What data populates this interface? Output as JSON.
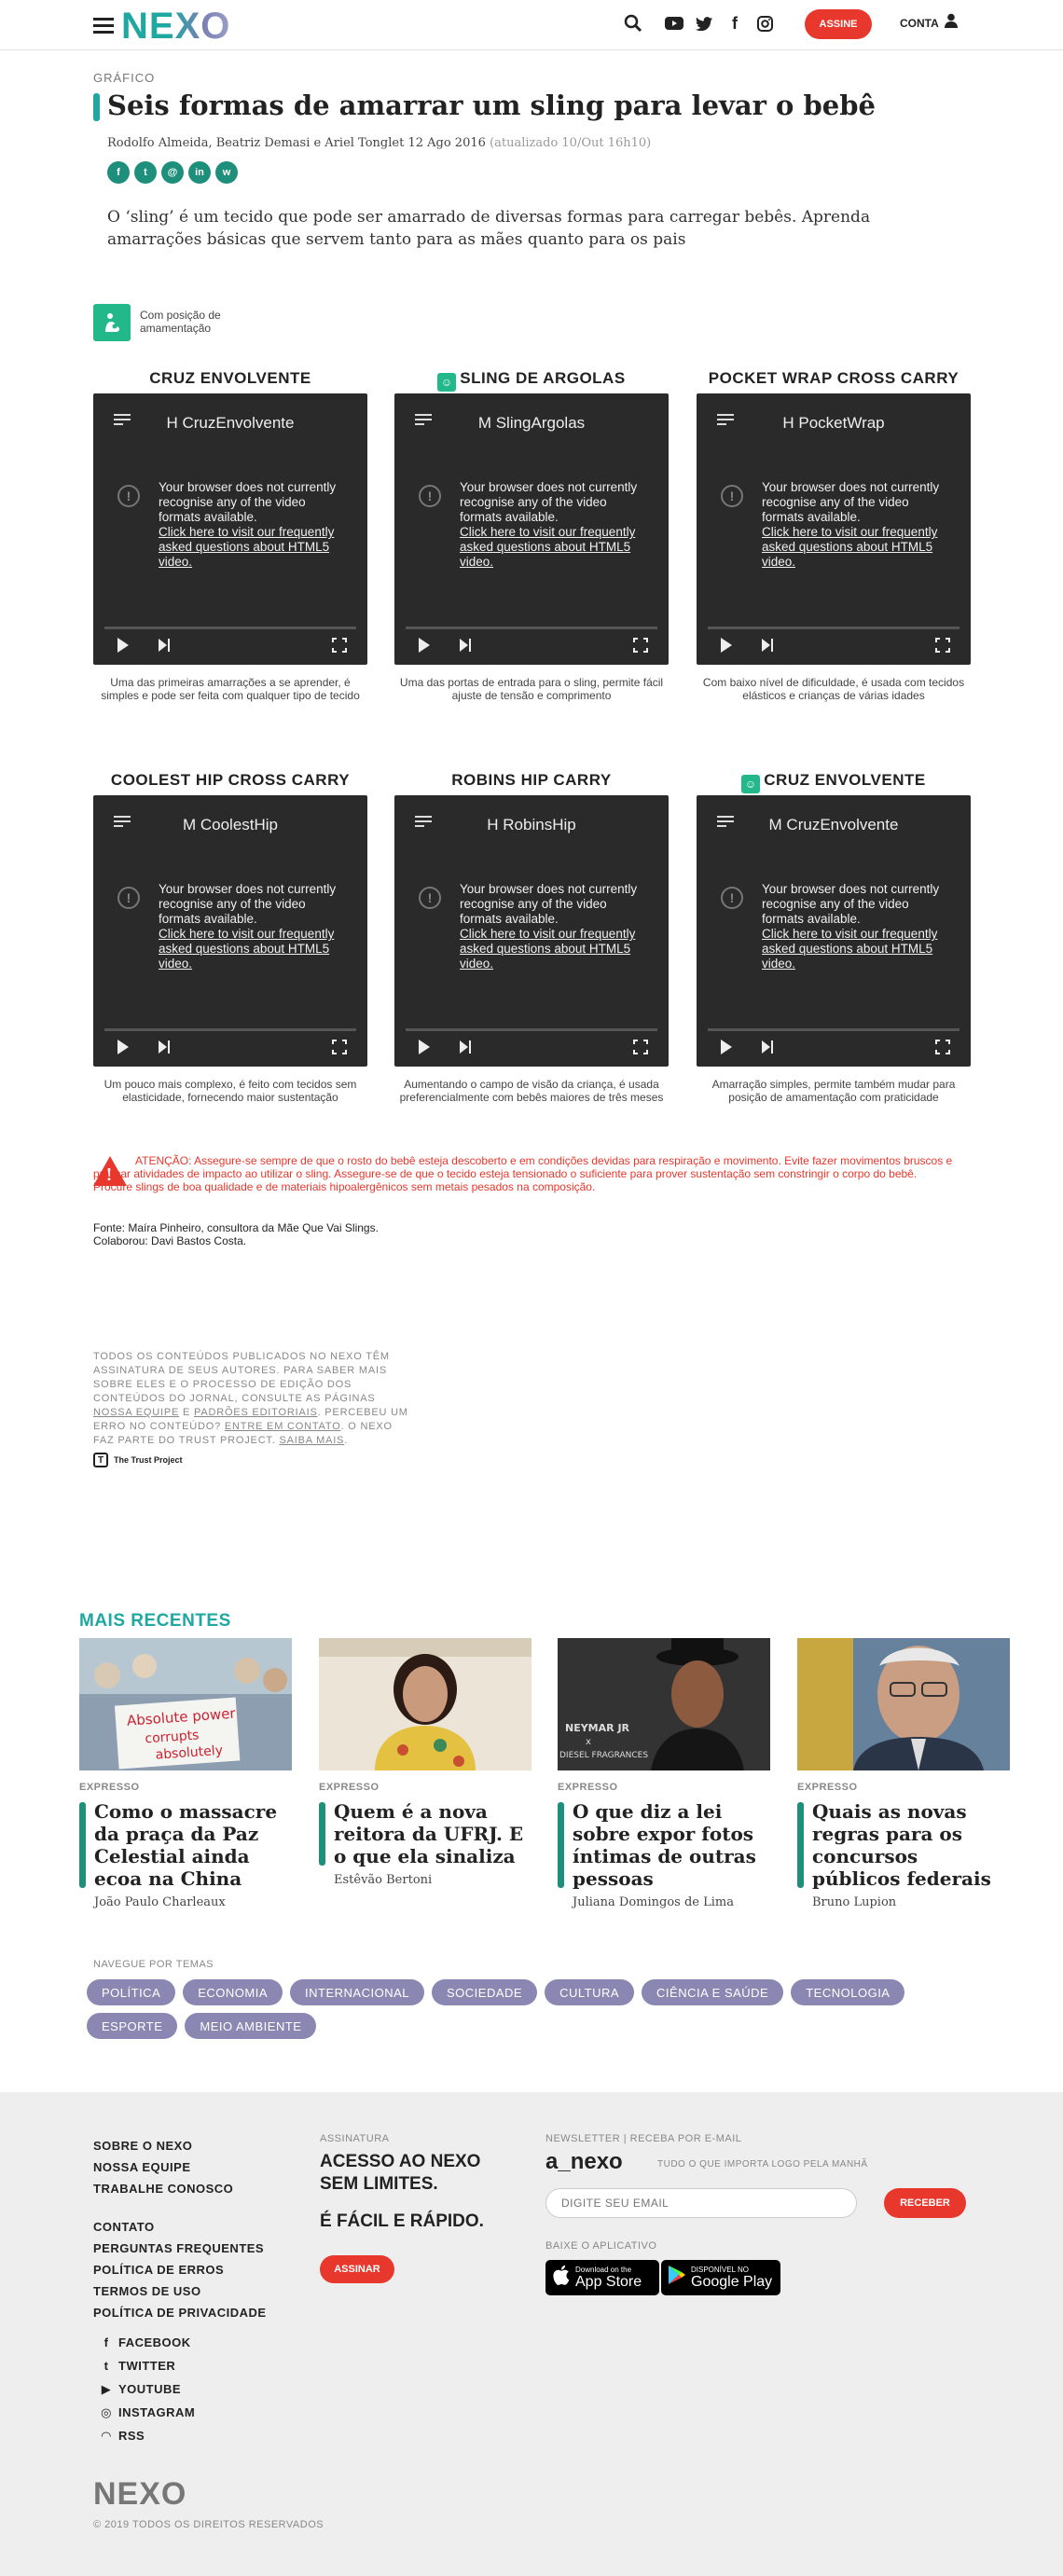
{
  "header": {
    "logo": "NEXO",
    "subscribe_label": "ASSINE",
    "account_label": "CONTA",
    "icons": [
      "menu-icon",
      "search-icon",
      "youtube-icon",
      "twitter-icon",
      "facebook-icon",
      "instagram-icon",
      "user-icon"
    ]
  },
  "article": {
    "kicker": "GRÁFICO",
    "title": "Seis formas de amarrar um sling para levar o bebê",
    "authors": "Rodolfo Almeida, Beatriz Demasi e Ariel Tonglet",
    "date": "12 Ago 2016",
    "updated": "(atualizado 10/Out 16h10)",
    "share": [
      {
        "icon": "facebook-icon",
        "glyph": "f"
      },
      {
        "icon": "twitter-icon",
        "glyph": "t"
      },
      {
        "icon": "email-icon",
        "glyph": "@"
      },
      {
        "icon": "linkedin-icon",
        "glyph": "in"
      },
      {
        "icon": "whatsapp-icon",
        "glyph": "w"
      }
    ],
    "lead": "O ‘sling’ é um tecido que pode ser amarrado de diversas formas para carregar bebês. Aprenda amarrações básicas que servem tanto para as mães quanto para os pais",
    "legend": "Com posição de amamentação"
  },
  "videos": [
    {
      "title": "CRUZ ENVOLVENTE",
      "breastfeeding": false,
      "player_title": "H CruzEnvolvente",
      "caption": "Uma das primeiras amarrações a se aprender, é simples e pode ser feita com qualquer tipo de tecido"
    },
    {
      "title": "SLING DE ARGOLAS",
      "breastfeeding": true,
      "player_title": "M SlingArgolas",
      "caption": "Uma das portas de entrada para o sling, permite fácil ajuste de tensão e comprimento"
    },
    {
      "title": "POCKET WRAP CROSS CARRY",
      "breastfeeding": false,
      "player_title": "H PocketWrap",
      "caption": "Com baixo nível de dificuldade, é usada com tecidos elásticos e crianças de várias idades"
    },
    {
      "title": "COOLEST HIP CROSS CARRY",
      "breastfeeding": false,
      "player_title": "M CoolestHip",
      "caption": "Um pouco mais complexo, é feito com tecidos sem elasticidade, fornecendo maior sustentação"
    },
    {
      "title": "ROBINS HIP CARRY",
      "breastfeeding": false,
      "player_title": "H RobinsHip",
      "caption": "Aumentando o campo de visão da criança, é usada preferencialmente com bebês maiores de três meses"
    },
    {
      "title": "CRUZ ENVOLVENTE",
      "breastfeeding": true,
      "player_title": "M CruzEnvolvente",
      "caption": "Amarração simples, permite também mudar para posição de amamentação com praticidade"
    }
  ],
  "player_msg": "Your browser does not currently recognise any of the video formats available.",
  "player_link": "Click here to visit our frequently asked questions about HTML5 video.",
  "warning": "ATENÇÃO: Assegure-se sempre de que o rosto do bebê esteja descoberto e em condições devidas para respiração e movimento. Evite fazer  movimentos bruscos e praticar atividades de impacto ao utilizar o sling. Assegure-se de que o tecido esteja tensionado o suficiente para prover sustentação sem constringir o corpo do bebê. Procure slings de boa qualidade e de materiais hipoalergênicos sem metais pesados na composição.",
  "source": "Fonte: Maíra Pinheiro, consultora da Mãe Que Vai Slings.",
  "collab": "Colaborou: Davi Bastos Costa.",
  "trust": {
    "text1": "Todos os conteúdos publicados no Nexo têm assinatura de seus autores. Para saber mais sobre eles e o processo de edição dos conteúdos do jornal, consulte as páginas ",
    "link1": "Nossa equipe",
    "and": " e ",
    "link2": "Padrões editoriais",
    "text2": ". Percebeu um erro no conteúdo? ",
    "link3": "Entre em contato",
    "text3": ". O Nexo faz parte do Trust Project. ",
    "link4": "Saiba mais",
    "end": ".",
    "logo": "The Trust Project"
  },
  "recent": {
    "heading": "MAIS RECENTES",
    "items": [
      {
        "section": "EXPRESSO",
        "title": "Como o massacre da praça da Paz Celestial ainda ecoa na China",
        "author": "João Paulo Charleaux",
        "sign_line1": "Absolute power",
        "sign_line2": "corrupts",
        "sign_line3": "absolutely"
      },
      {
        "section": "EXPRESSO",
        "title": "Quem é a nova reitora da UFRJ. E o que ela sinaliza",
        "author": "Estêvão Bertoni"
      },
      {
        "section": "EXPRESSO",
        "title": "O que diz a lei sobre expor fotos íntimas de outras pessoas",
        "author": "Juliana Domingos de Lima",
        "backdrop1": "NEYMAR JR",
        "backdrop2": "x",
        "backdrop3": "DIESEL FRAGRANCES"
      },
      {
        "section": "EXPRESSO",
        "title": "Quais as novas regras para os concursos públicos federais",
        "author": "Bruno Lupion"
      }
    ]
  },
  "topics": {
    "heading": "NAVEGUE POR TEMAS",
    "items": [
      "POLÍTICA",
      "ECONOMIA",
      "INTERNACIONAL",
      "SOCIEDADE",
      "CULTURA",
      "CIÊNCIA E SAÚDE",
      "TECNOLOGIA",
      "ESPORTE",
      "MEIO AMBIENTE"
    ]
  },
  "footer": {
    "links1": [
      "SOBRE O NEXO",
      "NOSSA EQUIPE",
      "TRABALHE CONOSCO"
    ],
    "links2": [
      "CONTATO",
      "PERGUNTAS FREQUENTES",
      "POLÍTICA DE ERROS",
      "TERMOS DE USO",
      "POLÍTICA DE PRIVACIDADE"
    ],
    "social": [
      {
        "icon": "facebook-icon",
        "glyph": "f",
        "label": "FACEBOOK"
      },
      {
        "icon": "twitter-icon",
        "glyph": "t",
        "label": "TWITTER"
      },
      {
        "icon": "youtube-icon",
        "glyph": "▶",
        "label": "YOUTUBE"
      },
      {
        "icon": "instagram-icon",
        "glyph": "◎",
        "label": "INSTAGRAM"
      },
      {
        "icon": "rss-icon",
        "glyph": "◠",
        "label": "RSS"
      }
    ],
    "sub_heading": "ASSINATURA",
    "sub_title": "ACESSO AO NEXO SEM LIMITES.",
    "sub_title2": "É FÁCIL E RÁPIDO.",
    "sub_button": "ASSINAR",
    "newsletter_heading": "NEWSLETTER | RECEBA POR E-MAIL",
    "newsletter_logo": "a_nexo",
    "newsletter_sub": "TUDO O QUE IMPORTA LOGO PELA MANHÃ",
    "email_placeholder": "DIGITE SEU EMAIL",
    "receive_button": "RECEBER",
    "app_heading": "BAIXE O APLICATIVO",
    "appstore_small": "Download on the",
    "appstore_big": "App Store",
    "googleplay_small": "DISPONÍVEL NO",
    "googleplay_big": "Google Play",
    "logo": "NEXO",
    "copyright": "© 2019 TODOS OS DIREITOS RESERVADOS"
  },
  "colors": {
    "accent": "#1ea8a1",
    "alert": "#e8372c",
    "topic_pill": "#8a87b3",
    "breastfeeding_icon": "#22b88a"
  }
}
